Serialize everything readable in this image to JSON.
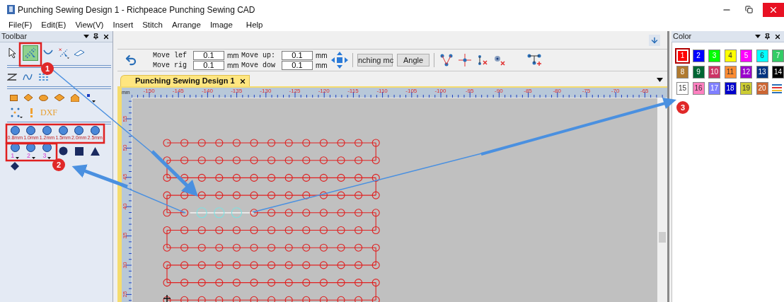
{
  "window": {
    "title": "Punching Sewing Design 1 - Richpeace Punching Sewing CAD"
  },
  "menu": [
    "File(F)",
    "Edit(E)",
    "View(V)",
    "Insert",
    "Stitch",
    "Arrange",
    "Image",
    "Help"
  ],
  "toolbar_panel": {
    "title": "Toolbar",
    "tools": [
      {
        "kind": "pointer",
        "selected": false
      },
      {
        "kind": "punch-line",
        "selected": true
      },
      {
        "kind": "curve",
        "selected": false
      },
      {
        "kind": "cross-line",
        "selected": false
      },
      {
        "kind": "eraser",
        "selected": false
      }
    ],
    "dxf_label": "DXF",
    "punch_sizes": [
      "0.8mm",
      "1.0mm",
      "1.2mm",
      "1.5mm",
      "2.0mm",
      "2.5mm"
    ],
    "punch_tools": [
      "1",
      "2",
      "3"
    ]
  },
  "move_fields": [
    {
      "label": "Move lef",
      "value": "0.1",
      "unit": "mm"
    },
    {
      "label": "Move up:",
      "value": "0.1",
      "unit": "mm"
    },
    {
      "label": "Move rig",
      "value": "0.1",
      "unit": "mm"
    },
    {
      "label": "Move dow",
      "value": "0.1",
      "unit": "mm"
    }
  ],
  "buttons": [
    "nching mc",
    "Angle"
  ],
  "tab": {
    "label": "Punching Sewing Design 1",
    "selected": true
  },
  "ruler": {
    "unit": "mm",
    "x_labels": [
      "-150",
      "-145",
      "-140",
      "-135",
      "-130",
      "-125",
      "-120",
      "-115",
      "-110",
      "-105",
      "-100",
      "-95",
      "-90",
      "-85",
      "-80",
      "-75",
      "-70",
      "-65"
    ],
    "y_labels": [
      "55",
      "50",
      "45",
      "40",
      "35",
      "30",
      "25"
    ]
  },
  "color_panel": {
    "title": "Color",
    "swatches": [
      {
        "label": "1",
        "color": "#ff0000",
        "selected": true
      },
      {
        "label": "2",
        "color": "#0000ff",
        "selected": false
      },
      {
        "label": "3",
        "color": "#00ff00",
        "selected": false
      },
      {
        "label": "4",
        "color": "#ffff00",
        "selected": false
      },
      {
        "label": "5",
        "color": "#ff00ff",
        "selected": false
      },
      {
        "label": "6",
        "color": "#00ffff",
        "selected": false
      },
      {
        "label": "7",
        "color": "#33cc66",
        "selected": false
      },
      {
        "label": "8",
        "color": "#b07a30",
        "selected": false
      },
      {
        "label": "9",
        "color": "#006633",
        "selected": false
      },
      {
        "label": "10",
        "color": "#cc3366",
        "selected": false
      },
      {
        "label": "11",
        "color": "#ff8c33",
        "selected": false
      },
      {
        "label": "12",
        "color": "#9900cc",
        "selected": false
      },
      {
        "label": "13",
        "color": "#003380",
        "selected": false
      },
      {
        "label": "14",
        "color": "#000000",
        "selected": false
      },
      {
        "label": "15",
        "color": "#ffffff",
        "selected": false
      },
      {
        "label": "16",
        "color": "#ff80c0",
        "selected": false
      },
      {
        "label": "17",
        "color": "#8080ff",
        "selected": false
      },
      {
        "label": "18",
        "color": "#0000cc",
        "selected": false
      },
      {
        "label": "19",
        "color": "#cccc33",
        "selected": false
      },
      {
        "label": "20",
        "color": "#cc6633",
        "selected": false
      }
    ]
  },
  "annotations": [
    "1",
    "2",
    "3"
  ]
}
